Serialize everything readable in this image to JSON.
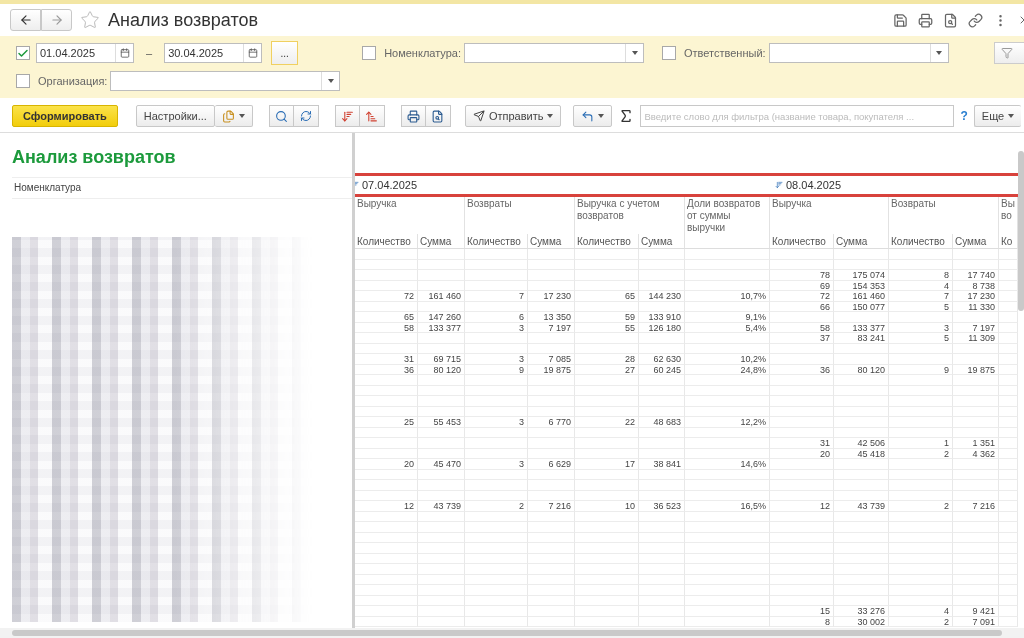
{
  "window": {
    "title": "Анализ возвратов",
    "favorite": false
  },
  "filters": {
    "rows": [
      {
        "items": [
          {
            "kind": "period",
            "checked": true,
            "from": "01.04.2025",
            "dash": "–",
            "to": "30.04.2025",
            "more": "..."
          },
          {
            "kind": "select",
            "checked": false,
            "label": "Номенклатура:"
          },
          {
            "kind": "select",
            "checked": false,
            "label": "Ответственный:"
          }
        ]
      },
      {
        "items": [
          {
            "kind": "select",
            "checked": false,
            "label": "Организация:"
          }
        ]
      }
    ]
  },
  "toolbar": {
    "generate_button": "Сформировать",
    "settings_button": "Настройки...",
    "send_button": "Отправить",
    "search": {
      "placeholder": "Введите слово для фильтра (название товара, покупателя ..."
    },
    "help": "?",
    "more_button": "Еще"
  },
  "report": {
    "title": "Анализ возвратов",
    "row_header": "Номенклатура",
    "periods": [
      {
        "date": "07.04.2025",
        "groups": [
          {
            "title": "Выручка",
            "subcolumns": [
              "Количество",
              "Сумма"
            ]
          },
          {
            "title": "Возвраты",
            "subcolumns": [
              "Количество",
              "Сумма"
            ]
          },
          {
            "title": "Выручка с учетом возвратов",
            "subcolumns": [
              "Количество",
              "Сумма"
            ]
          },
          {
            "title": "Доли возвратов от суммы выручки"
          }
        ]
      },
      {
        "date": "08.04.2025",
        "groups": [
          {
            "title": "Выручка",
            "subcolumns": [
              "Количество",
              "Сумма"
            ]
          },
          {
            "title": "Возвраты",
            "subcolumns": [
              "Количество",
              "Сумма"
            ]
          },
          {
            "title": "Вы во",
            "subcolumns": [
              "Ко"
            ]
          }
        ]
      }
    ],
    "rows": [
      {
        "cells": [
          null,
          null,
          null,
          null,
          null,
          null,
          null,
          null,
          null,
          null,
          null
        ]
      },
      {
        "cells": [
          null,
          null,
          null,
          null,
          null,
          null,
          null,
          null,
          null,
          null,
          null
        ]
      },
      {
        "cells": [
          null,
          null,
          null,
          null,
          null,
          null,
          null,
          "78",
          "175 074",
          "8",
          "17 740"
        ]
      },
      {
        "cells": [
          null,
          null,
          null,
          null,
          null,
          null,
          null,
          "69",
          "154 353",
          "4",
          "8 738"
        ]
      },
      {
        "cells": [
          "72",
          "161 460",
          "7",
          "17 230",
          "65",
          "144 230",
          "10,7%",
          "72",
          "161 460",
          "7",
          "17 230"
        ]
      },
      {
        "cells": [
          null,
          null,
          null,
          null,
          null,
          null,
          null,
          "66",
          "150 077",
          "5",
          "11 330"
        ]
      },
      {
        "cells": [
          "65",
          "147 260",
          "6",
          "13 350",
          "59",
          "133 910",
          "9,1%",
          null,
          null,
          null,
          null
        ]
      },
      {
        "cells": [
          "58",
          "133 377",
          "3",
          "7 197",
          "55",
          "126 180",
          "5,4%",
          "58",
          "133 377",
          "3",
          "7 197"
        ]
      },
      {
        "cells": [
          null,
          null,
          null,
          null,
          null,
          null,
          null,
          "37",
          "83 241",
          "5",
          "11 309"
        ]
      },
      {
        "cells": [
          null,
          null,
          null,
          null,
          null,
          null,
          null,
          null,
          null,
          null,
          null
        ]
      },
      {
        "cells": [
          "31",
          "69 715",
          "3",
          "7 085",
          "28",
          "62 630",
          "10,2%",
          null,
          null,
          null,
          null
        ]
      },
      {
        "cells": [
          "36",
          "80 120",
          "9",
          "19 875",
          "27",
          "60 245",
          "24,8%",
          "36",
          "80 120",
          "9",
          "19 875"
        ]
      },
      {
        "cells": [
          null,
          null,
          null,
          null,
          null,
          null,
          null,
          null,
          null,
          null,
          null
        ]
      },
      {
        "cells": [
          null,
          null,
          null,
          null,
          null,
          null,
          null,
          null,
          null,
          null,
          null
        ]
      },
      {
        "cells": [
          null,
          null,
          null,
          null,
          null,
          null,
          null,
          null,
          null,
          null,
          null
        ]
      },
      {
        "cells": [
          null,
          null,
          null,
          null,
          null,
          null,
          null,
          null,
          null,
          null,
          null
        ]
      },
      {
        "cells": [
          "25",
          "55 453",
          "3",
          "6 770",
          "22",
          "48 683",
          "12,2%",
          null,
          null,
          null,
          null
        ]
      },
      {
        "cells": [
          null,
          null,
          null,
          null,
          null,
          null,
          null,
          null,
          null,
          null,
          null
        ]
      },
      {
        "cells": [
          null,
          null,
          null,
          null,
          null,
          null,
          null,
          "31",
          "42 506",
          "1",
          "1 351"
        ]
      },
      {
        "cells": [
          null,
          null,
          null,
          null,
          null,
          null,
          null,
          "20",
          "45 418",
          "2",
          "4 362"
        ]
      },
      {
        "cells": [
          "20",
          "45 470",
          "3",
          "6 629",
          "17",
          "38 841",
          "14,6%",
          null,
          null,
          null,
          null
        ]
      },
      {
        "cells": [
          null,
          null,
          null,
          null,
          null,
          null,
          null,
          null,
          null,
          null,
          null
        ]
      },
      {
        "cells": [
          null,
          null,
          null,
          null,
          null,
          null,
          null,
          null,
          null,
          null,
          null
        ]
      },
      {
        "cells": [
          null,
          null,
          null,
          null,
          null,
          null,
          null,
          null,
          null,
          null,
          null
        ]
      },
      {
        "cells": [
          "12",
          "43 739",
          "2",
          "7 216",
          "10",
          "36 523",
          "16,5%",
          "12",
          "43 739",
          "2",
          "7 216"
        ]
      },
      {
        "cells": [
          null,
          null,
          null,
          null,
          null,
          null,
          null,
          null,
          null,
          null,
          null
        ]
      },
      {
        "cells": [
          null,
          null,
          null,
          null,
          null,
          null,
          null,
          null,
          null,
          null,
          null
        ]
      },
      {
        "cells": [
          null,
          null,
          null,
          null,
          null,
          null,
          null,
          null,
          null,
          null,
          null
        ]
      },
      {
        "cells": [
          null,
          null,
          null,
          null,
          null,
          null,
          null,
          null,
          null,
          null,
          null
        ]
      },
      {
        "cells": [
          null,
          null,
          null,
          null,
          null,
          null,
          null,
          null,
          null,
          null,
          null
        ]
      },
      {
        "cells": [
          null,
          null,
          null,
          null,
          null,
          null,
          null,
          null,
          null,
          null,
          null
        ]
      },
      {
        "cells": [
          null,
          null,
          null,
          null,
          null,
          null,
          null,
          null,
          null,
          null,
          null
        ]
      },
      {
        "cells": [
          null,
          null,
          null,
          null,
          null,
          null,
          null,
          null,
          null,
          null,
          null
        ]
      },
      {
        "cells": [
          null,
          null,
          null,
          null,
          null,
          null,
          null,
          null,
          null,
          null,
          null
        ]
      },
      {
        "cells": [
          null,
          null,
          null,
          null,
          null,
          null,
          null,
          "15",
          "33 276",
          "4",
          "9 421"
        ]
      },
      {
        "cells": [
          null,
          null,
          null,
          null,
          null,
          null,
          null,
          "8",
          "30 002",
          "2",
          "7 091"
        ]
      }
    ]
  }
}
